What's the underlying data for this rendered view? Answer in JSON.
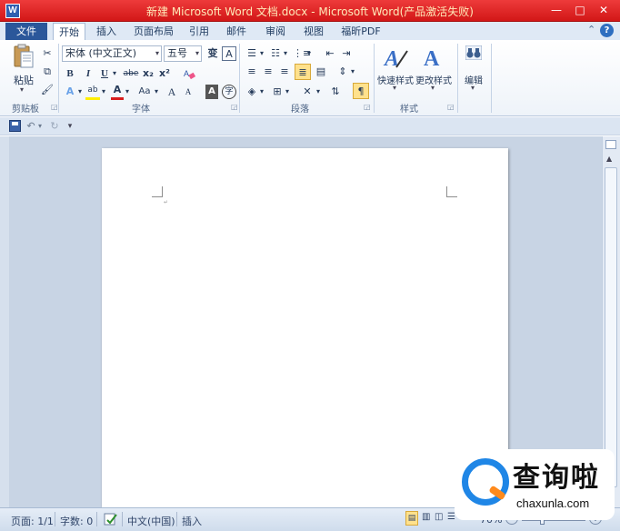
{
  "window": {
    "title": "新建 Microsoft Word 文档.docx - Microsoft Word(产品激活失败)",
    "app_icon": "W",
    "minimize_glyph": "—",
    "maximize_glyph": "□",
    "close_glyph": "✕"
  },
  "tabs": {
    "file": "文件",
    "items": [
      "开始",
      "插入",
      "页面布局",
      "引用",
      "邮件",
      "审阅",
      "视图",
      "福昕PDF"
    ],
    "active_index": 0,
    "minimize_ribbon_glyph": "⌃",
    "help_glyph": "?"
  },
  "ribbon": {
    "clipboard": {
      "paste_label": "粘贴",
      "group_label": "剪贴板"
    },
    "font": {
      "font_name": "宋体 (中文正文)",
      "font_size": "五号",
      "bold": "B",
      "italic": "I",
      "underline": "U",
      "strikethrough": "abe",
      "subscript": "x₂",
      "superscript": "x²",
      "text_effects": "A",
      "highlight": "ab",
      "font_color": "A",
      "char_shading": "Aa",
      "grow_font": "A",
      "shrink_font": "A",
      "clear_format": "A",
      "phonetic": "变",
      "char_border": "A",
      "enclose_char": "字",
      "group_label": "字体"
    },
    "paragraph": {
      "group_label": "段落"
    },
    "styles": {
      "quick_styles_label": "快速样式",
      "change_styles_label": "更改样式",
      "group_label": "样式"
    },
    "editing": {
      "label": "编辑"
    }
  },
  "statusbar": {
    "page": "页面: 1/1",
    "words": "字数: 0",
    "language": "中文(中国)",
    "mode": "插入",
    "zoom": "70%",
    "zoom_minus": "−",
    "zoom_plus": "+"
  },
  "watermark": {
    "brand_cn": "查询啦",
    "brand_en": "chaxunla.com"
  },
  "colors": {
    "titlebar": "#d21717",
    "file_tab": "#2b579a",
    "highlight_yellow": "#ffe18c",
    "font_color_red": "#d81e1e"
  }
}
